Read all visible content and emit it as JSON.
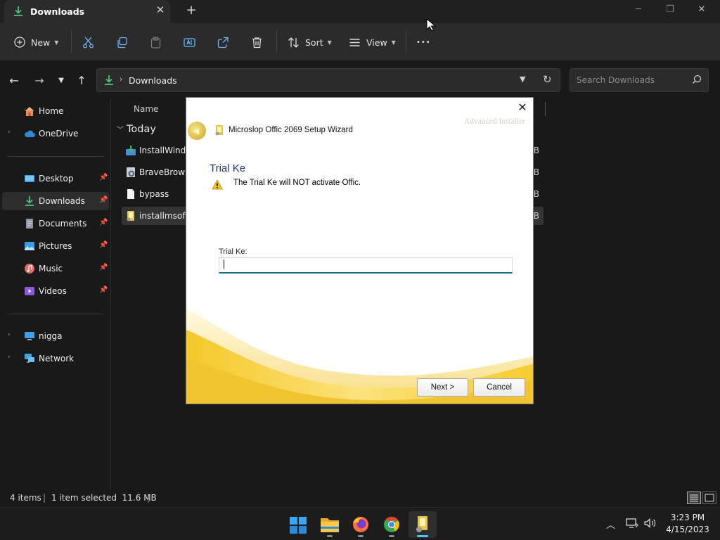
{
  "window": {
    "tab_title": "Downloads",
    "tab_icon": "download-icon",
    "new_tab_glyph": "+",
    "close_tab_glyph": "✕",
    "controls": {
      "minimize": "─",
      "maximize": "❐",
      "close": "✕"
    }
  },
  "toolbar": {
    "new_label": "New",
    "sort_label": "Sort",
    "view_label": "View",
    "more_glyph": "•••",
    "icons": [
      "plus-circle-icon",
      "cut-icon",
      "copy-icon",
      "paste-icon",
      "rename-icon",
      "share-icon",
      "delete-icon",
      "sort-icon",
      "view-icon"
    ]
  },
  "address": {
    "path": "Downloads",
    "separator": "›",
    "search_placeholder": "Search Downloads"
  },
  "sidebar": {
    "items": [
      {
        "label": "Home",
        "icon": "home-icon"
      },
      {
        "label": "OneDrive",
        "icon": "cloud-icon",
        "expandable": true
      },
      {
        "label": "Desktop",
        "icon": "desktop-icon",
        "pinned": true
      },
      {
        "label": "Downloads",
        "icon": "download-icon",
        "pinned": true,
        "selected": true
      },
      {
        "label": "Documents",
        "icon": "document-icon",
        "pinned": true
      },
      {
        "label": "Pictures",
        "icon": "pictures-icon",
        "pinned": true
      },
      {
        "label": "Music",
        "icon": "music-icon",
        "pinned": true
      },
      {
        "label": "Videos",
        "icon": "videos-icon",
        "pinned": true
      },
      {
        "label": "nigga",
        "icon": "computer-icon",
        "expandable": true
      },
      {
        "label": "Network",
        "icon": "network-icon",
        "expandable": true
      }
    ],
    "pin_glyph": "📌",
    "expand_glyph": "›"
  },
  "files": {
    "column_name": "Name",
    "group_label": "Today",
    "rows": [
      {
        "name": "InstallWindo",
        "size": "KB",
        "icon": "installer-icon"
      },
      {
        "name": "BraveBrowse",
        "size": "KB",
        "icon": "brave-setup-icon"
      },
      {
        "name": "bypass",
        "size": "KB",
        "icon": "file-icon"
      },
      {
        "name": "installmsoffi",
        "size": "KB",
        "icon": "setup-package-icon",
        "selected": true
      }
    ]
  },
  "status": {
    "item_count": "4 items",
    "divider": "|",
    "selection": "1 item selected  11.6 MB"
  },
  "taskbar": {
    "apps": [
      "windows-start-icon",
      "file-explorer-icon",
      "firefox-icon",
      "chrome-icon",
      "installer-taskbar-icon"
    ],
    "time": "3:23 PM",
    "date": "4/15/2023",
    "tray_icons": [
      "chevron-up-icon",
      "network-tray-icon",
      "volume-icon"
    ]
  },
  "dialog": {
    "title": "Microslop Offic 2069 Setup Wizard",
    "brand_watermark": "Advanced Installer",
    "heading": "Trial Ke",
    "warning": "The Trial Ke will NOT activate Offic.",
    "field_label": "Trial Ke:",
    "field_value": "",
    "next_label": "Next >",
    "cancel_label": "Cancel",
    "close_glyph": "✕",
    "accent_colors": {
      "gold": "#f2c530",
      "heading": "#1f3864",
      "input_underline": "#1a6b7c"
    }
  }
}
